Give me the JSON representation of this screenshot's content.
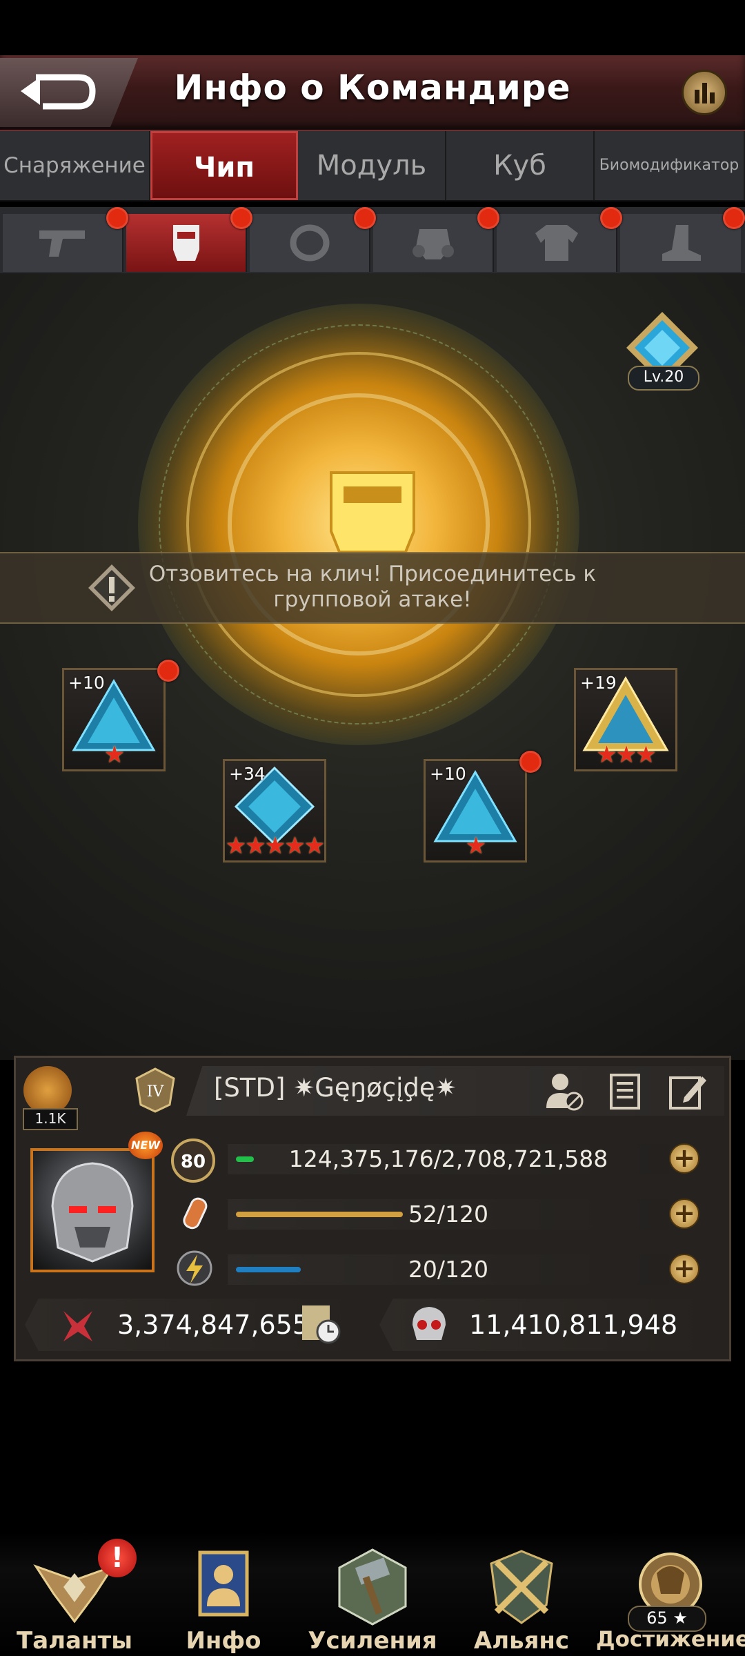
{
  "header": {
    "title": "Инфо о Командире"
  },
  "tabs": [
    {
      "label": "Снаряжение",
      "active": false
    },
    {
      "label": "Чип",
      "active": true
    },
    {
      "label": "Модуль",
      "active": false
    },
    {
      "label": "Куб",
      "active": false
    },
    {
      "label": "Биомодификатор",
      "active": false
    }
  ],
  "subtabs": [
    {
      "icon": "pistol-icon",
      "active": false
    },
    {
      "icon": "chip-slot-icon",
      "active": true
    },
    {
      "icon": "ring-icon",
      "active": false
    },
    {
      "icon": "gas-mask-icon",
      "active": false
    },
    {
      "icon": "armor-icon",
      "active": false
    },
    {
      "icon": "boot-icon",
      "active": false
    }
  ],
  "chip_level": "Lv.20",
  "banner": {
    "text_line1": "Отзовитесь на клич! Присоедините к",
    "text": "Отзовитесь на клич! Присоединитесь к групповой атаке!"
  },
  "chips": [
    {
      "level": "+10",
      "stars": "★"
    },
    {
      "level": "+34",
      "stars": "★★★★★"
    },
    {
      "level": "+10",
      "stars": "★"
    },
    {
      "level": "+19",
      "stars": "★★★"
    }
  ],
  "commander": {
    "likes": "1.1K",
    "name": "[STD]  ✷Gęŋøçįḑę✷",
    "new_badge": "NEW",
    "level": "80",
    "exp": "124,375,176/2,708,721,588",
    "stamina": "52/120",
    "energy": "20/120",
    "power": "3,374,847,655",
    "kills": "11,410,811,948",
    "exp_fraction": 0.046,
    "stamina_fraction": 0.433,
    "energy_fraction": 0.167
  },
  "nav": [
    {
      "label": "Таланты",
      "icon": "talents-icon"
    },
    {
      "label": "Инфо",
      "icon": "info-icon"
    },
    {
      "label": "Усиления",
      "icon": "boosts-icon"
    },
    {
      "label": "Альянс",
      "icon": "alliance-icon"
    },
    {
      "label": "Достижение",
      "icon": "achievement-icon"
    }
  ],
  "achievement_count": "65 ★",
  "talent_alert": "!",
  "colors": {
    "accent": "#a02020",
    "gold": "#f2b43a",
    "red_dot": "#e22a10"
  }
}
